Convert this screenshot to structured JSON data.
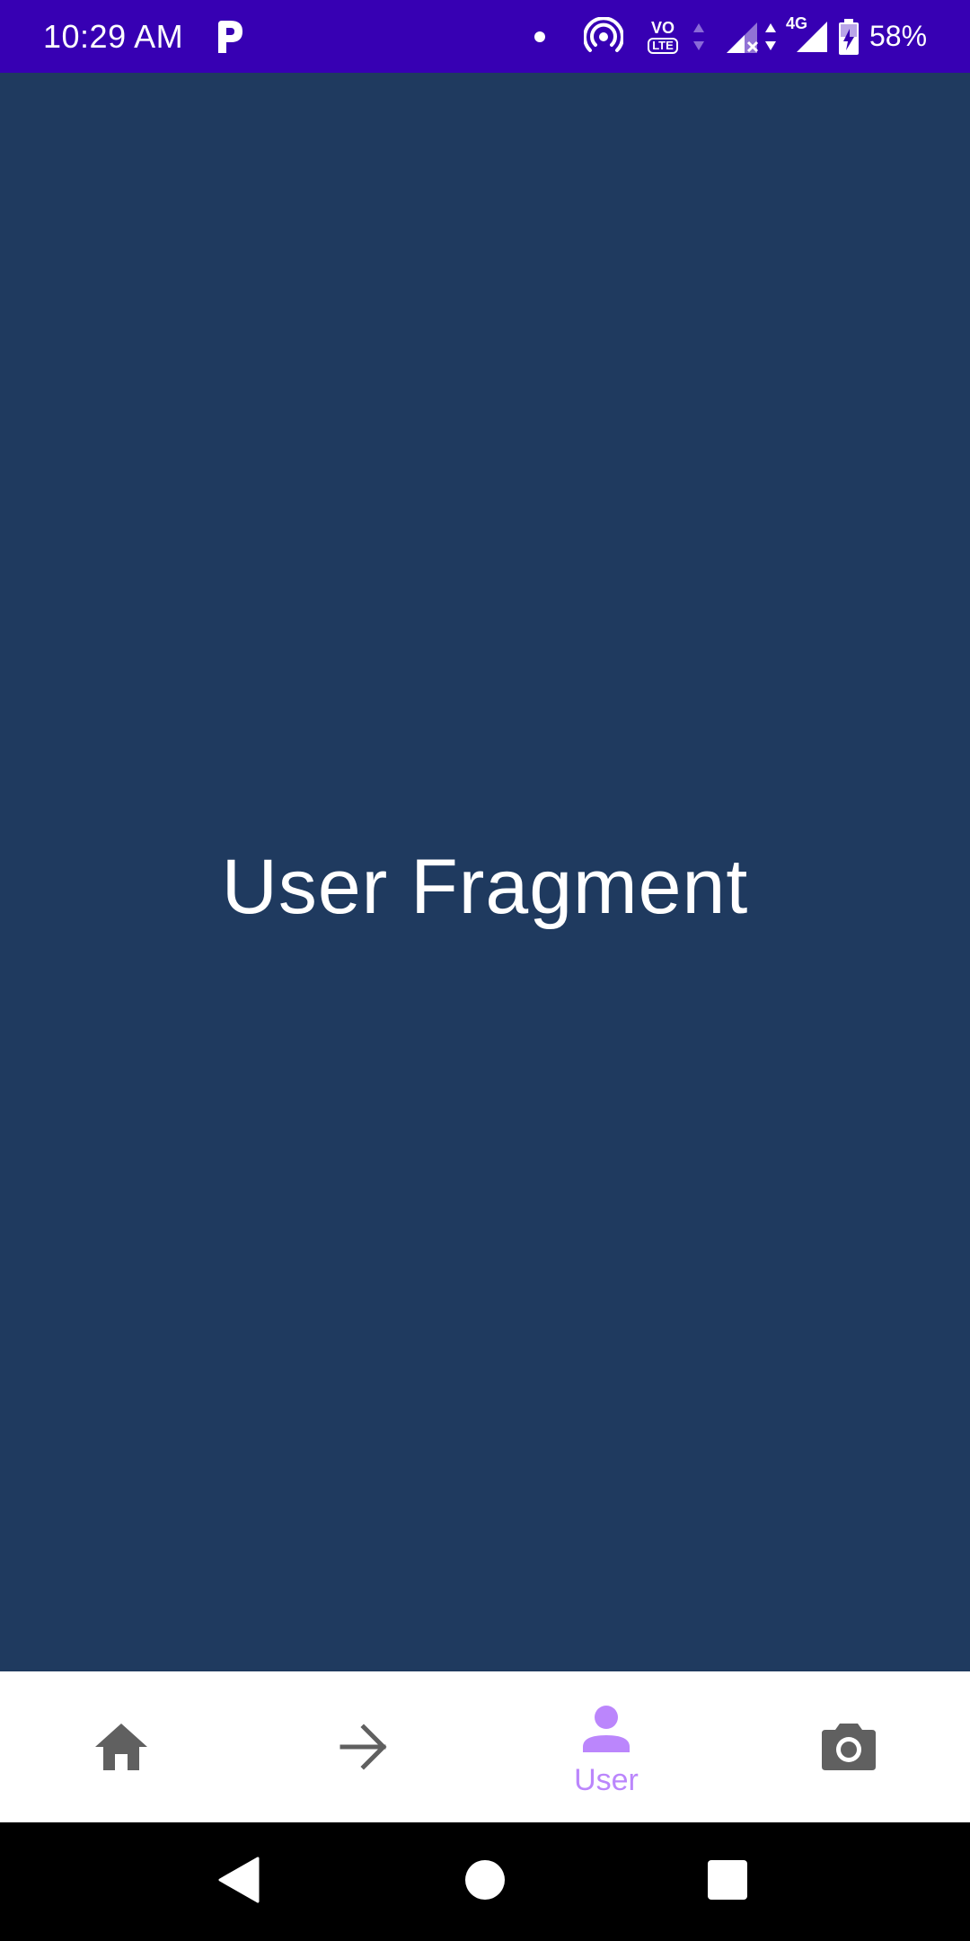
{
  "status_bar": {
    "time": "10:29 AM",
    "network_type": "4G",
    "volte_label": "VO",
    "lte_label": "LTE",
    "battery_percent": "58%",
    "background_color": "#3700b3"
  },
  "content": {
    "title": "User Fragment",
    "background_color": "#1f3a5f"
  },
  "bottom_nav": {
    "items": [
      {
        "icon": "home-icon",
        "label": "",
        "selected": false
      },
      {
        "icon": "arrow-right-icon",
        "label": "",
        "selected": false
      },
      {
        "icon": "person-icon",
        "label": "User",
        "selected": true
      },
      {
        "icon": "camera-icon",
        "label": "",
        "selected": false
      }
    ],
    "active_color": "#bb86fc",
    "inactive_color": "#606060"
  },
  "system_nav": {
    "buttons": [
      "back-icon",
      "home-circle-icon",
      "recents-icon"
    ]
  }
}
